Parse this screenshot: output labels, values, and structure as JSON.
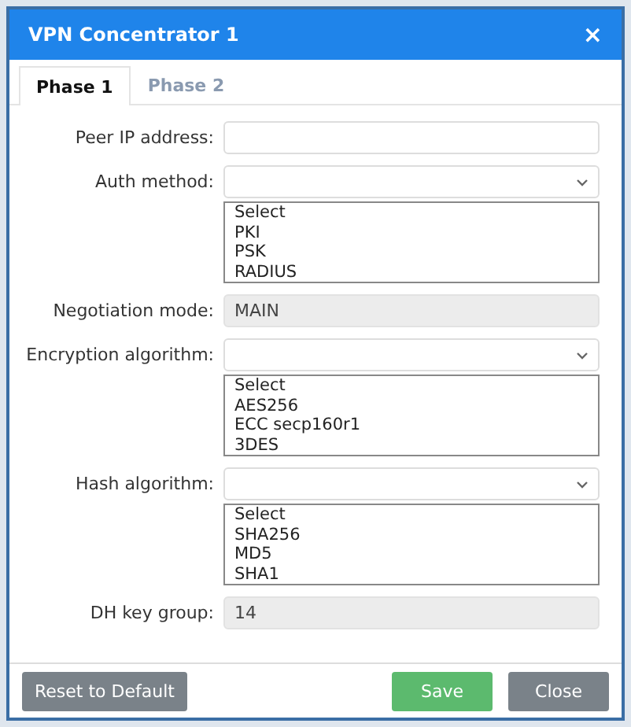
{
  "window": {
    "title": "VPN Concentrator 1",
    "close": "×"
  },
  "tabs": [
    {
      "label": "Phase 1",
      "selected": true
    },
    {
      "label": "Phase 2",
      "selected": false
    }
  ],
  "fields": [
    {
      "kind": "text",
      "label": "Peer IP address:"
    },
    {
      "kind": "select",
      "label": "Auth method:",
      "options": [
        "Select",
        "PKI",
        "PSK",
        "RADIUS"
      ]
    },
    {
      "kind": "readonly",
      "label": "Negotiation mode:",
      "value": "MAIN"
    },
    {
      "kind": "select",
      "label": "Encryption algorithm:",
      "options": [
        "Select",
        "AES256",
        "ECC secp160r1",
        "3DES"
      ]
    },
    {
      "kind": "select",
      "label": "Hash algorithm:",
      "options": [
        "Select",
        "SHA256",
        "MD5",
        "SHA1"
      ]
    },
    {
      "kind": "readonly",
      "label": "DH key group:",
      "value": "14"
    }
  ],
  "buttons": [
    {
      "label": "Reset to Default",
      "kind": "secondary"
    },
    {
      "label": "Save",
      "kind": "primary"
    },
    {
      "label": "Close",
      "kind": "secondary"
    }
  ]
}
